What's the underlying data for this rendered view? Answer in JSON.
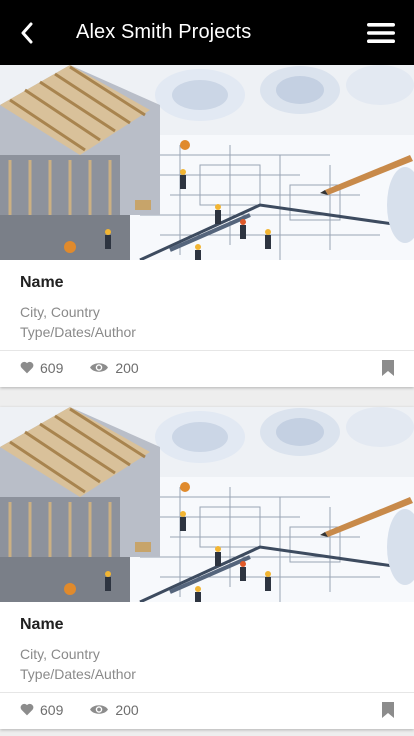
{
  "appbar": {
    "title": "Alex Smith Projects",
    "back_icon": "chevron-left-icon",
    "menu_icon": "hamburger-menu-icon"
  },
  "colors": {
    "appbar_bg": "#000000",
    "page_bg": "#eeeeee",
    "meta_text": "#8a8a8a",
    "icon_grey": "#8c8c8c"
  },
  "projects": [
    {
      "name": "Name",
      "location": "City, Country",
      "details": "Type/Dates/Author",
      "likes": "609",
      "views": "200",
      "like_icon": "heart-icon",
      "view_icon": "eye-icon",
      "bookmark_icon": "bookmark-icon"
    },
    {
      "name": "Name",
      "location": "City, Country",
      "details": "Type/Dates/Author",
      "likes": "609",
      "views": "200",
      "like_icon": "heart-icon",
      "view_icon": "eye-icon",
      "bookmark_icon": "bookmark-icon"
    }
  ]
}
